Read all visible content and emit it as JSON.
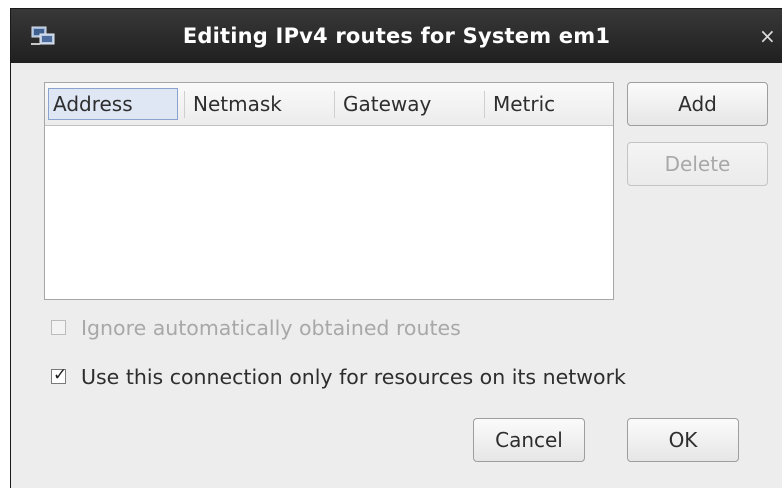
{
  "window": {
    "title": "Editing IPv4 routes for System em1",
    "close_glyph": "×",
    "app_icon": "network-connection-icon"
  },
  "table": {
    "columns": [
      "Address",
      "Netmask",
      "Gateway",
      "Metric"
    ],
    "rows": []
  },
  "buttons": {
    "add": "Add",
    "delete": "Delete",
    "cancel": "Cancel",
    "ok": "OK"
  },
  "options": {
    "ignore_auto_routes": {
      "label": "Ignore automatically obtained routes",
      "checked": false,
      "enabled": false
    },
    "use_only_for_network": {
      "label": "Use this connection only for resources on its network",
      "checked": true,
      "enabled": true
    }
  },
  "colors": {
    "titlebar": "#2b2b2b",
    "dialog_background": "#ededed",
    "selected_header": "#dfe7f5"
  }
}
